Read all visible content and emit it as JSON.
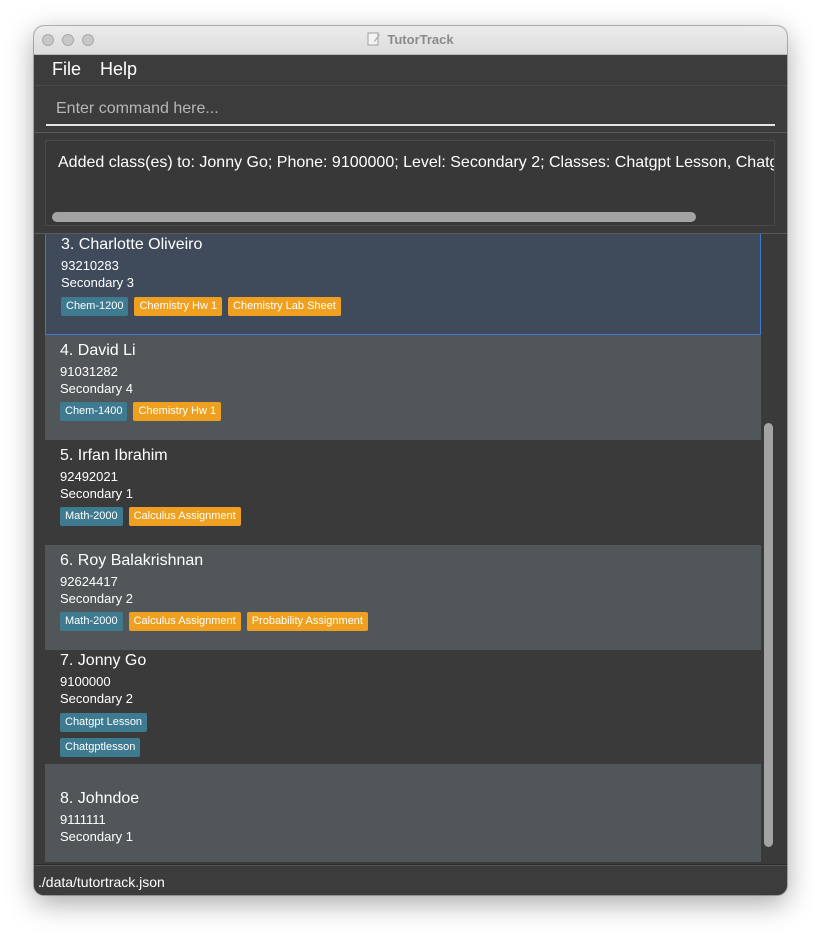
{
  "window": {
    "title": "TutorTrack"
  },
  "menu": {
    "file_label": "File",
    "help_label": "Help"
  },
  "command": {
    "placeholder": "Enter command here...",
    "value": ""
  },
  "result": {
    "message": "Added class(es) to: Jonny Go; Phone: 9100000; Level: Secondary 2; Classes: Chatgpt Lesson, Chatgptlesson"
  },
  "persons": [
    {
      "name": "3. Charlotte Oliveiro",
      "phone": "93210283",
      "level": "Secondary 3",
      "classes": [
        "Chem-1200"
      ],
      "assignments": [
        "Chemistry Hw 1",
        "Chemistry Lab Sheet"
      ]
    },
    {
      "name": "4. David Li",
      "phone": "91031282",
      "level": "Secondary 4",
      "classes": [
        "Chem-1400"
      ],
      "assignments": [
        "Chemistry Hw 1"
      ]
    },
    {
      "name": "5. Irfan Ibrahim",
      "phone": "92492021",
      "level": "Secondary 1",
      "classes": [
        "Math-2000"
      ],
      "assignments": [
        "Calculus Assignment"
      ]
    },
    {
      "name": "6. Roy Balakrishnan",
      "phone": "92624417",
      "level": "Secondary 2",
      "classes": [
        "Math-2000"
      ],
      "assignments": [
        "Calculus Assignment",
        "Probability Assignment"
      ]
    },
    {
      "name": "7. Jonny Go",
      "phone": "9100000",
      "level": "Secondary 2",
      "classes": [
        "Chatgpt Lesson",
        "Chatgptlesson"
      ],
      "assignments": []
    },
    {
      "name": "8. Johndoe",
      "phone": "9111111",
      "level": "Secondary 1",
      "classes": [],
      "assignments": []
    }
  ],
  "status": {
    "path": "./data/tutortrack.json"
  }
}
